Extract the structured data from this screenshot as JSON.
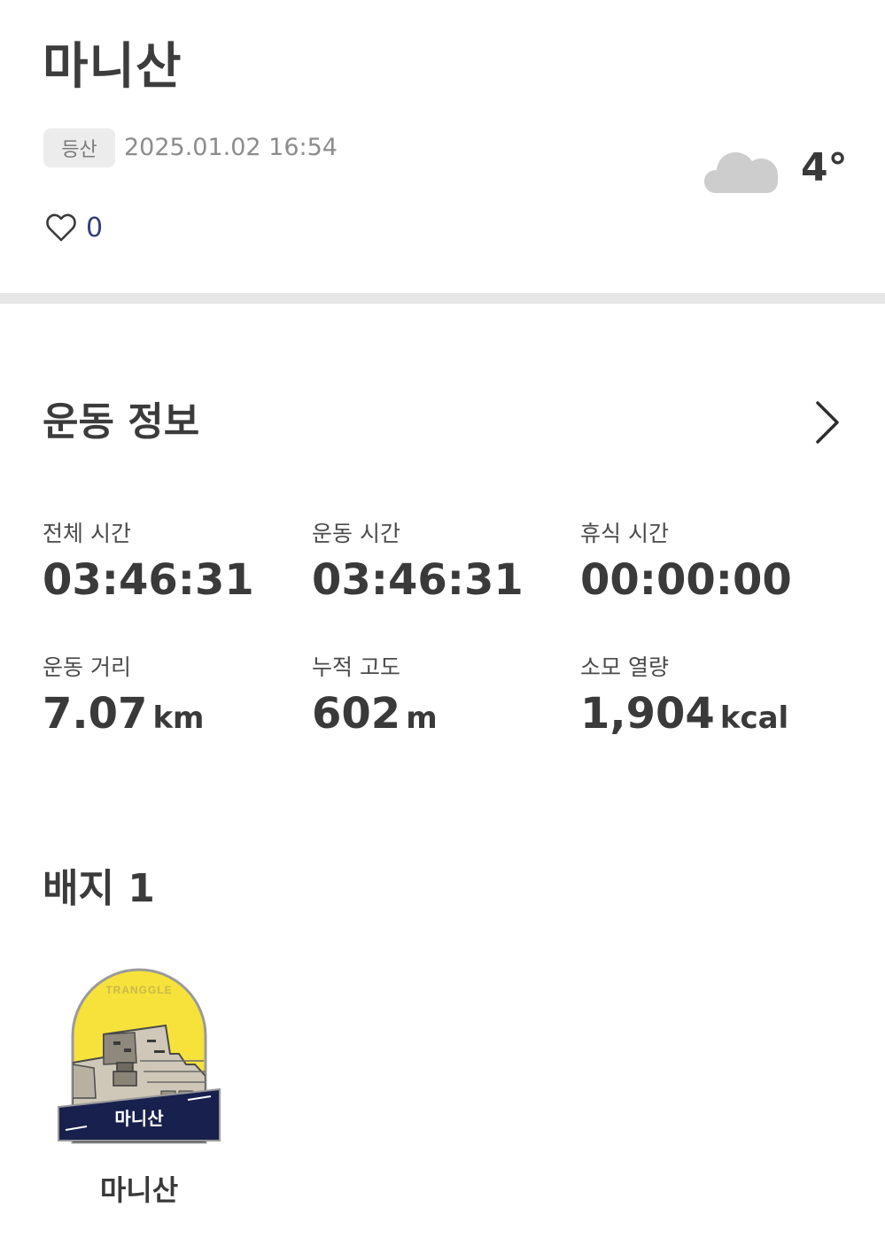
{
  "header": {
    "title": "마니산",
    "tag": "등산",
    "datetime": "2025.01.02 16:54",
    "weather_icon": "cloud-icon",
    "temperature": "4°",
    "like_icon": "heart-outline-icon",
    "like_count": "0"
  },
  "exercise": {
    "section_title": "운동 정보",
    "more_icon": "chevron-right-icon",
    "stats": [
      {
        "label": "전체 시간",
        "value": "03:46:31",
        "unit": ""
      },
      {
        "label": "운동 시간",
        "value": "03:46:31",
        "unit": ""
      },
      {
        "label": "휴식 시간",
        "value": "00:00:00",
        "unit": ""
      },
      {
        "label": "운동 거리",
        "value": "7.07",
        "unit": "km"
      },
      {
        "label": "누적 고도",
        "value": "602",
        "unit": "m"
      },
      {
        "label": "소모 열량",
        "value": "1,904",
        "unit": "kcal"
      }
    ]
  },
  "badges": {
    "section_title": "배지 1",
    "items": [
      {
        "name": "마니산",
        "emblem_text": "TRANGGLE",
        "banner_text": "마니산"
      }
    ]
  },
  "colors": {
    "badge_yellow": "#f6e23a",
    "badge_navy": "#18204e",
    "divider": "#e6e6e6",
    "like_count": "#34407a"
  }
}
